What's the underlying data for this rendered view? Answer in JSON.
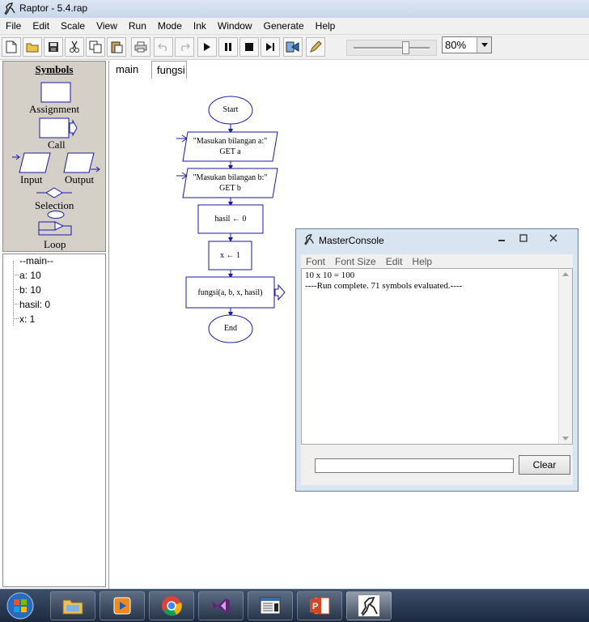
{
  "window": {
    "title": "Raptor - 5.4.rap",
    "menu": [
      "File",
      "Edit",
      "Scale",
      "View",
      "Run",
      "Mode",
      "Ink",
      "Window",
      "Generate",
      "Help"
    ],
    "zoom": "80%",
    "zoom_slider_level": 0.7
  },
  "symbols": {
    "heading": "Symbols",
    "assignment": "Assignment",
    "call": "Call",
    "input": "Input",
    "output": "Output",
    "selection": "Selection",
    "loop": "Loop"
  },
  "variables": {
    "scope": "--main--",
    "items": [
      "a: 10",
      "b: 10",
      "hasil: 0",
      "x: 1"
    ]
  },
  "tabs": [
    "main",
    "fungsi"
  ],
  "flowchart": {
    "start": "Start",
    "input_a_prompt": "\"Masukan bilangan a:\"",
    "input_a_get": "GET a",
    "input_b_prompt": "\"Masukan bilangan b:\"",
    "input_b_get": "GET b",
    "assign_hasil": "hasil ← 0",
    "assign_x": "x ← 1",
    "call_fungsi": "fungsi(a, b, x, hasil)",
    "end": "End"
  },
  "console": {
    "title": "MasterConsole",
    "menu": [
      "Font",
      "Font Size",
      "Edit",
      "Help"
    ],
    "output": [
      "10 x 10 = 100",
      "----Run complete.  71 symbols evaluated.----"
    ],
    "input_value": "",
    "clear_label": "Clear"
  },
  "colors": {
    "flowchart_stroke": "#1a1aa6",
    "panel": "#d4d0c8",
    "taskbar": "#1c2940"
  },
  "taskbar": {
    "apps": [
      "file-explorer-icon",
      "media-player-icon",
      "chrome-icon",
      "visual-studio-icon",
      "window-app-icon",
      "powerpoint-icon",
      "raptor-icon"
    ]
  }
}
